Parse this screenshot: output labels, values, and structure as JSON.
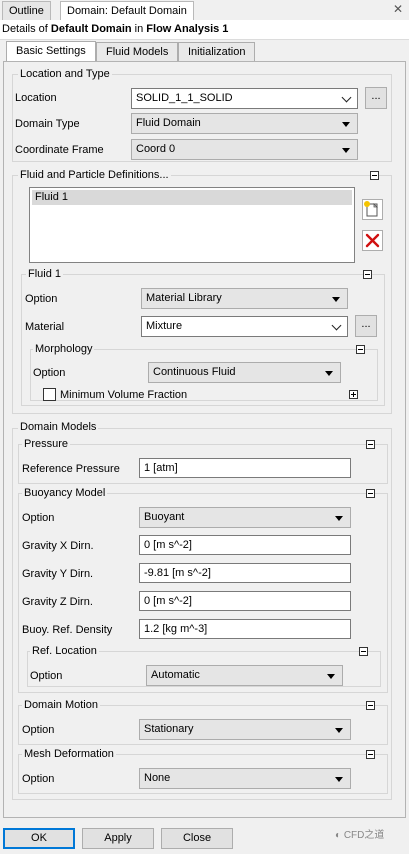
{
  "top_tabs": [
    "Outline",
    "Domain: Default Domain"
  ],
  "details": {
    "prefix": "Details of ",
    "object": "Default Domain",
    "middle": " in ",
    "analysis": "Flow Analysis 1"
  },
  "inner_tabs": [
    "Basic Settings",
    "Fluid Models",
    "Initialization"
  ],
  "location_type": {
    "title": "Location and Type",
    "location_label": "Location",
    "location_value": "SOLID_1_1_SOLID",
    "domain_type_label": "Domain Type",
    "domain_type_value": "Fluid Domain",
    "coord_label": "Coordinate Frame",
    "coord_value": "Coord 0",
    "browse": "..."
  },
  "fluid_defs": {
    "title": "Fluid and Particle Definitions...",
    "items": [
      "Fluid 1"
    ],
    "fluid1": {
      "title": "Fluid 1",
      "option_label": "Option",
      "option_value": "Material Library",
      "material_label": "Material",
      "material_value": "Mixture",
      "browse": "...",
      "morphology": {
        "title": "Morphology",
        "option_label": "Option",
        "option_value": "Continuous Fluid",
        "min_vol_label": "Minimum Volume Fraction",
        "min_vol_checked": false
      }
    }
  },
  "domain_models": {
    "title": "Domain Models",
    "pressure": {
      "title": "Pressure",
      "ref_label": "Reference Pressure",
      "ref_value": "1 [atm]"
    },
    "buoyancy": {
      "title": "Buoyancy Model",
      "option_label": "Option",
      "option_value": "Buoyant",
      "gx_label": "Gravity X Dirn.",
      "gx_value": "0 [m s^-2]",
      "gy_label": "Gravity Y Dirn.",
      "gy_value": "-9.81 [m s^-2]",
      "gz_label": "Gravity Z Dirn.",
      "gz_value": "0 [m s^-2]",
      "density_label": "Buoy. Ref. Density",
      "density_value": "1.2 [kg m^-3]",
      "ref_location": {
        "title": "Ref. Location",
        "option_label": "Option",
        "option_value": "Automatic"
      }
    },
    "motion": {
      "title": "Domain Motion",
      "option_label": "Option",
      "option_value": "Stationary"
    },
    "mesh": {
      "title": "Mesh Deformation",
      "option_label": "Option",
      "option_value": "None"
    }
  },
  "buttons": {
    "ok": "OK",
    "apply": "Apply",
    "close": "Close"
  },
  "watermark": "CFD之道"
}
